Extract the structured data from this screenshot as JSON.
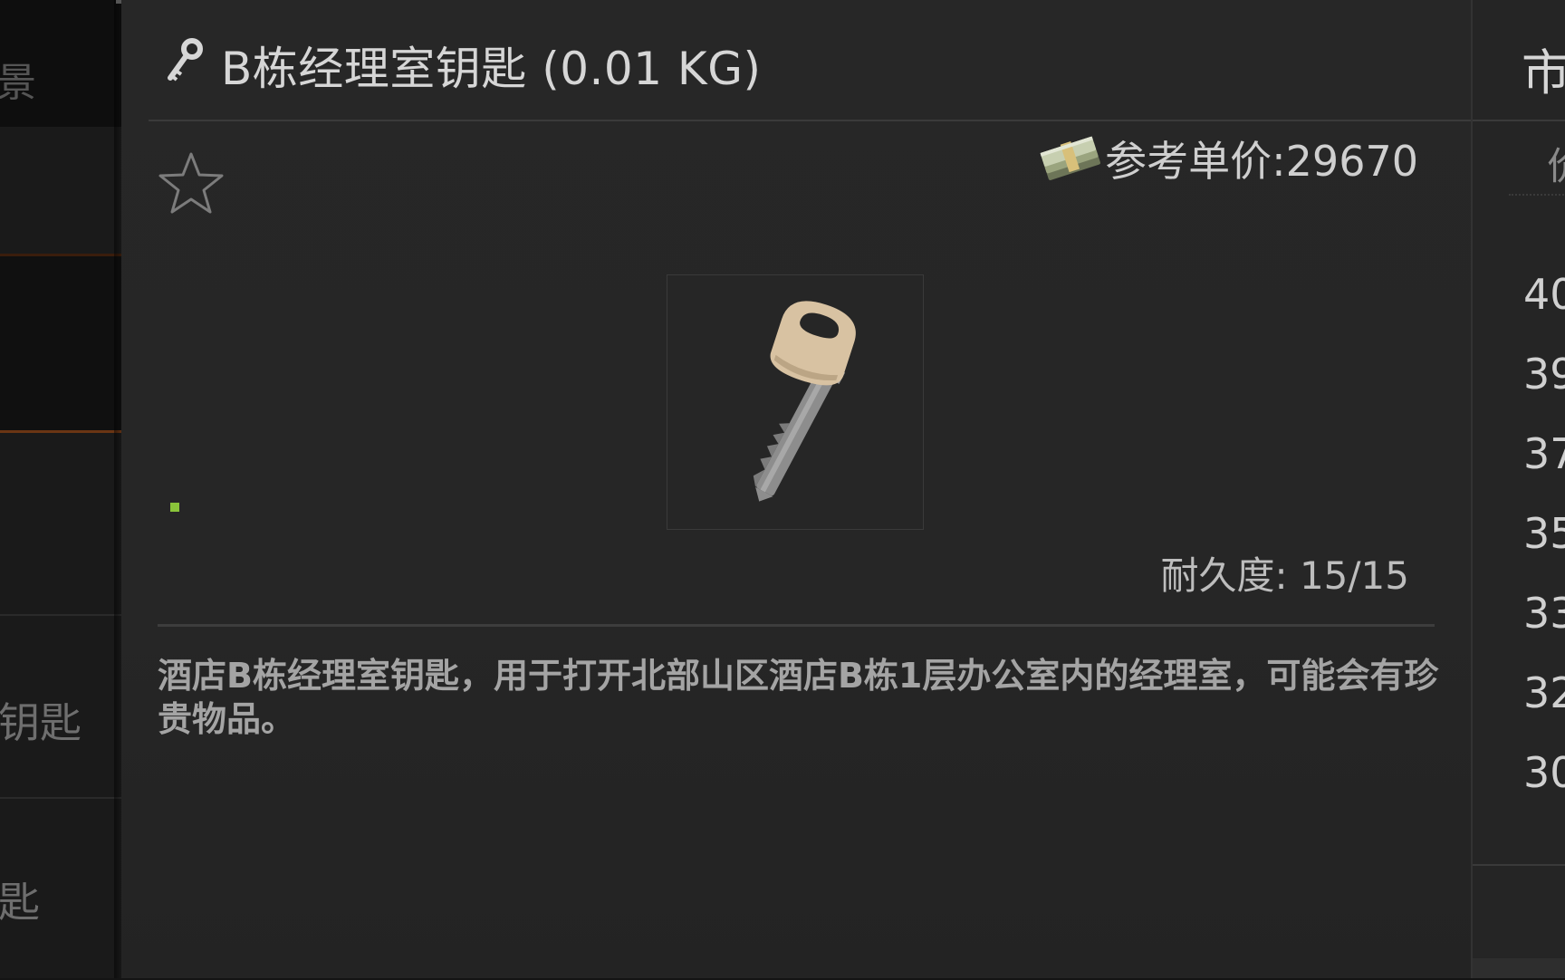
{
  "left_list": {
    "top_fragment": "景",
    "rows": [
      {
        "label": ""
      },
      {
        "label": ""
      },
      {
        "label": ""
      },
      {
        "label": "钥匙"
      },
      {
        "label": "匙"
      }
    ]
  },
  "item": {
    "title": "B栋经理室钥匙 (0.01 KG)",
    "price_text": "参考单价:29670",
    "durability_text": "耐久度: 15/15",
    "description": "酒店B栋经理室钥匙，用于打开北部山区酒店B栋1层办公室内的经理室，可能会有珍贵物品。"
  },
  "market_panel": {
    "title_fragment": "市",
    "header_fragment": "价",
    "values": [
      "40",
      "39",
      "37",
      "35",
      "33",
      "32",
      "30"
    ]
  },
  "colors": {
    "panel_bg": "#272727",
    "accent_orange": "#6a3514",
    "indicator_green": "#8ac43a"
  }
}
